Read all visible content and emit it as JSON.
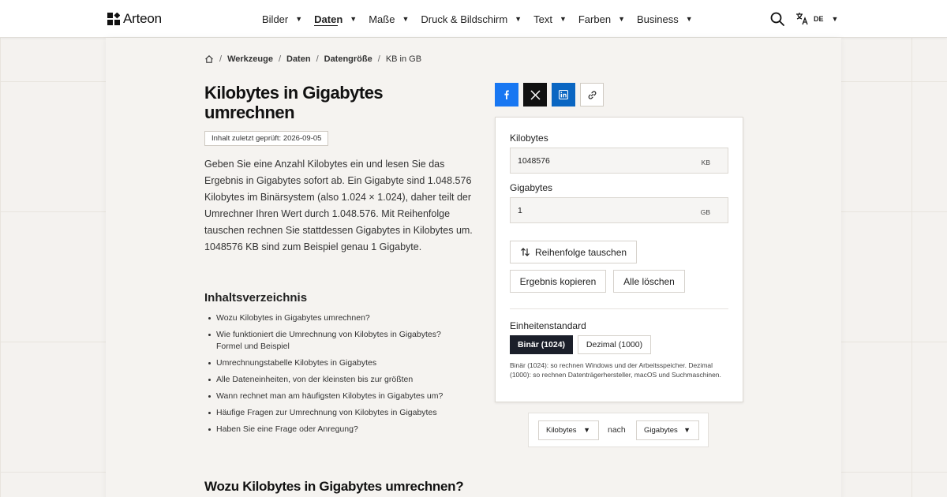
{
  "header": {
    "brand": "Arteon",
    "nav": [
      {
        "label": "Bilder",
        "active": false
      },
      {
        "label": "Daten",
        "active": true
      },
      {
        "label": "Maße",
        "active": false
      },
      {
        "label": "Druck & Bildschirm",
        "active": false
      },
      {
        "label": "Text",
        "active": false
      },
      {
        "label": "Farben",
        "active": false
      },
      {
        "label": "Business",
        "active": false
      }
    ],
    "language": "DE"
  },
  "breadcrumb": [
    "Werkzeuge",
    "Daten",
    "Datengröße",
    "KB in GB"
  ],
  "article": {
    "title": "Kilobytes in Gigabytes umrechnen",
    "reviewed_badge": "Inhalt zuletzt geprüft: 2026-09-05",
    "intro": "Geben Sie eine Anzahl Kilobytes ein und lesen Sie das Ergebnis in Gigabytes sofort ab. Ein Gigabyte sind 1.048.576 Kilobytes im Binärsystem (also 1.024 × 1.024), daher teilt der Umrechner Ihren Wert durch 1.048.576. Mit Reihenfolge tauschen rechnen Sie stattdessen Gigabytes in Kilobytes um. 1048576 KB sind zum Beispiel genau 1 Gigabyte.",
    "toc_title": "Inhaltsverzeichnis",
    "toc": [
      "Wozu Kilobytes in Gigabytes umrechnen?",
      "Wie funktioniert die Umrechnung von Kilobytes in Gigabytes? Formel und Beispiel",
      "Umrechnungstabelle Kilobytes in Gigabytes",
      "Alle Dateneinheiten, von der kleinsten bis zur größten",
      "Wann rechnet man am häufigsten Kilobytes in Gigabytes um?",
      "Häufige Fragen zur Umrechnung von Kilobytes in Gigabytes",
      "Haben Sie eine Frage oder Anregung?"
    ],
    "section_title": "Wozu Kilobytes in Gigabytes umrechnen?"
  },
  "share": {
    "icons": [
      "facebook-icon",
      "x-icon",
      "linkedin-icon",
      "link-icon"
    ]
  },
  "converter": {
    "from_label": "Kilobytes",
    "from_value": "1048576",
    "from_unit": "KB",
    "to_label": "Gigabytes",
    "to_value": "1",
    "to_unit": "GB",
    "swap_label": "Reihenfolge tauschen",
    "copy_label": "Ergebnis kopieren",
    "clear_label": "Alle löschen",
    "standard_label": "Einheitenstandard",
    "standard_options": [
      "Binär (1024)",
      "Dezimal (1000)"
    ],
    "standard_selected": "Binär (1024)",
    "standard_note": "Binär (1024): so rechnen Windows und der Arbeitsspeicher. Dezimal (1000): so rechnen Datenträgerhersteller, macOS und Suchmaschinen."
  },
  "unit_picker": {
    "from": "Kilobytes",
    "connector": "nach",
    "to": "Gigabytes"
  },
  "colors": {
    "page_bg": "#f4f2ef",
    "facebook": "#1877f2",
    "x": "#111111",
    "linkedin": "#0a66c2",
    "segment_active": "#1b1f2a"
  }
}
